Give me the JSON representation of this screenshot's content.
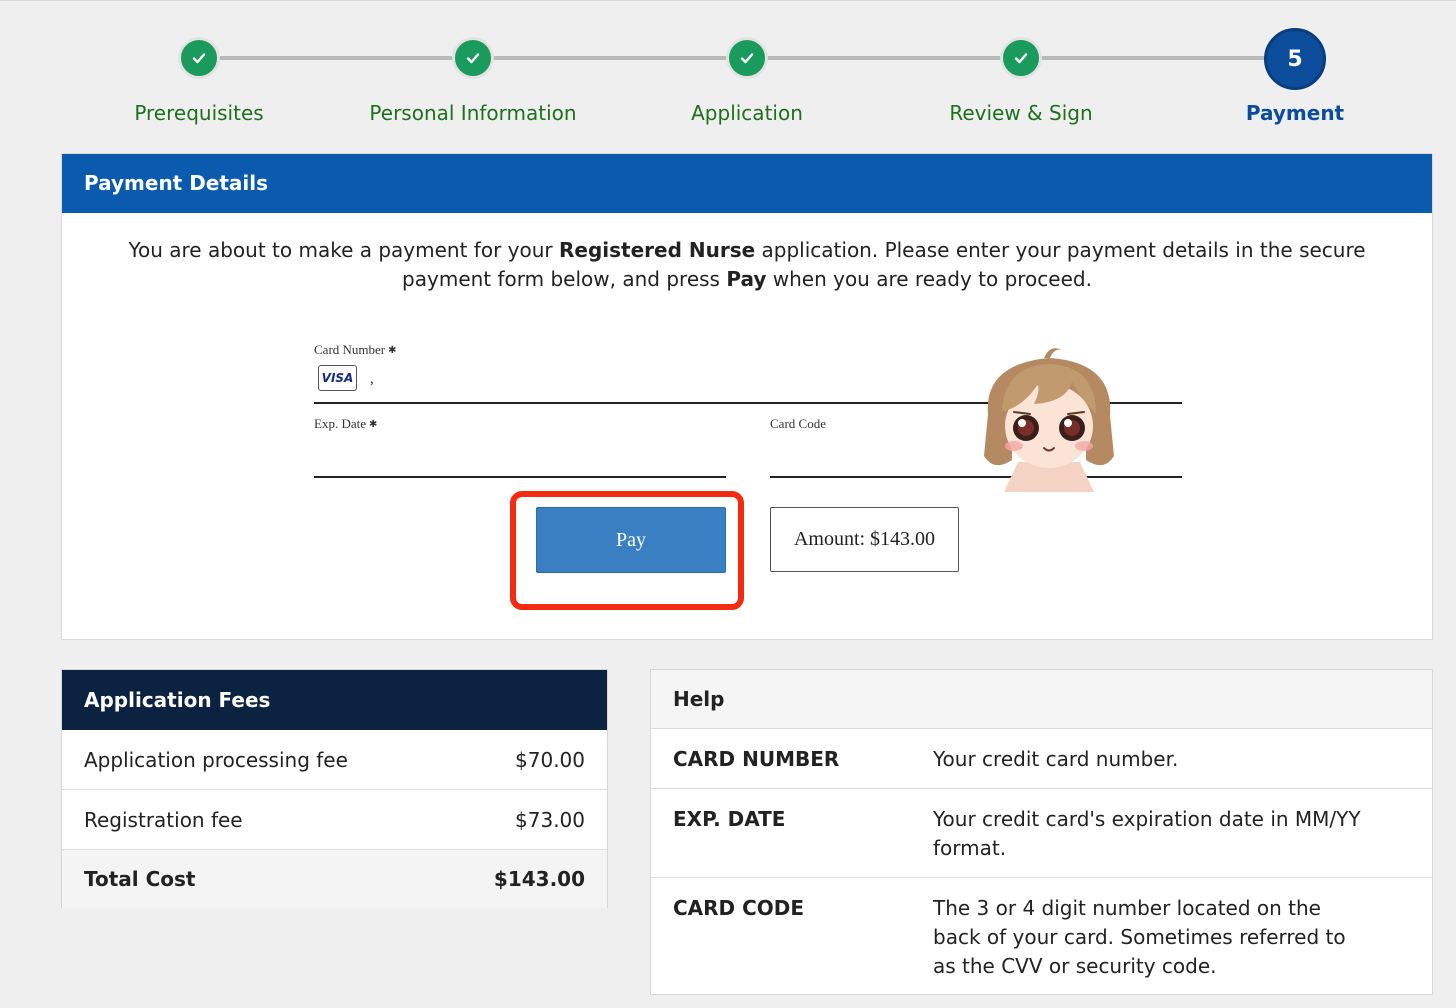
{
  "stepper": {
    "steps": [
      {
        "label": "Prerequisites",
        "state": "complete"
      },
      {
        "label": "Personal Information",
        "state": "complete"
      },
      {
        "label": "Application",
        "state": "complete"
      },
      {
        "label": "Review & Sign",
        "state": "complete"
      },
      {
        "label": "Payment",
        "state": "active",
        "number": "5"
      }
    ],
    "complete_color": "#1a9a5c",
    "active_color": "#0b4d9a"
  },
  "payment": {
    "header": "Payment Details",
    "intro": {
      "part1": "You are about to make a payment for your ",
      "bold1": "Registered Nurse",
      "part2": " application. Please enter your payment details in the secure payment form below, and press ",
      "bold2": "Pay",
      "part3": " when you are ready to proceed."
    },
    "form": {
      "card_number_label": "Card Number",
      "required_mark": "✱",
      "card_brand": "VISA",
      "card_number_value": ",",
      "exp_label": "Exp. Date",
      "exp_value": "",
      "code_label": "Card Code",
      "code_value": "",
      "pay_label": "Pay",
      "amount": "Amount: $143.00"
    },
    "header_color": "#0a5aae",
    "highlight_color": "#f42b12"
  },
  "fees": {
    "header": "Application Fees",
    "rows": [
      {
        "label": "Application processing fee",
        "amount": "$70.00"
      },
      {
        "label": "Registration fee",
        "amount": "$73.00"
      }
    ],
    "total": {
      "label": "Total Cost",
      "amount": "$143.00"
    }
  },
  "help": {
    "header": "Help",
    "rows": [
      {
        "term": "CARD NUMBER",
        "desc": "Your credit card number."
      },
      {
        "term": "EXP. DATE",
        "desc": "Your credit card's expiration date in MM/YY format."
      },
      {
        "term": "CARD CODE",
        "desc": "The 3 or 4 digit number located on the back of your card. Sometimes referred to as the CVV or security code."
      }
    ]
  }
}
